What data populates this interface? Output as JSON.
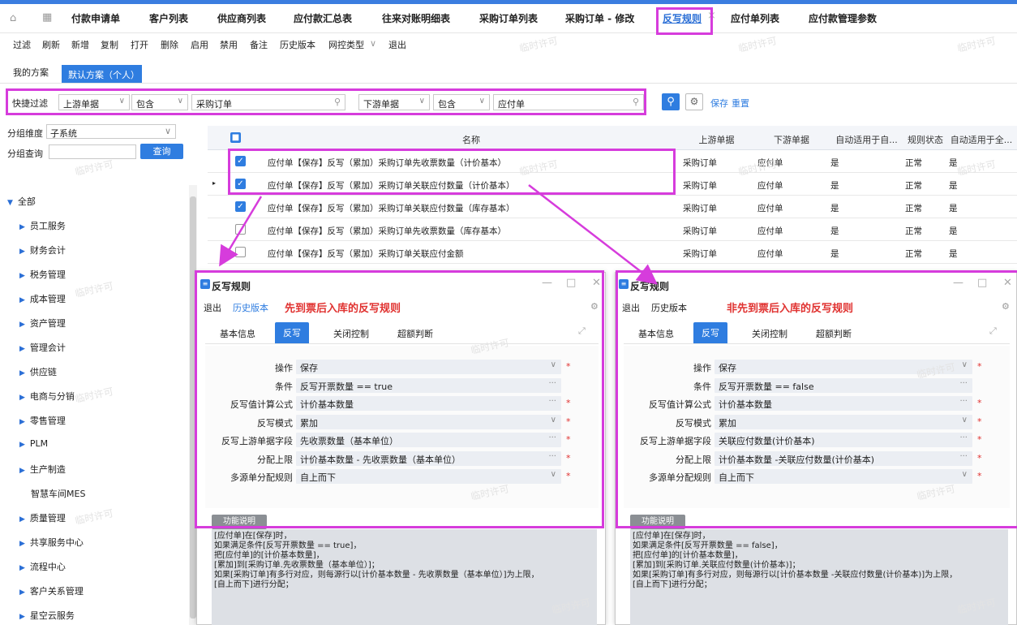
{
  "tabs": [
    "付款申请单",
    "客户列表",
    "供应商列表",
    "应付款汇总表",
    "往来对账明细表",
    "采购订单列表",
    "采购订单 - 修改",
    "反写规则",
    "应付单列表",
    "应付款管理参数"
  ],
  "toolbar": [
    "过滤",
    "刷新",
    "新增",
    "复制",
    "打开",
    "删除",
    "启用",
    "禁用",
    "备注",
    "历史版本",
    "网控类型",
    "退出"
  ],
  "plans": {
    "mine": "我的方案",
    "active": "默认方案（个人）"
  },
  "filter": {
    "label": "快捷过滤",
    "field1": "上游单据",
    "op1": "包含",
    "val1": "采购订单",
    "field2": "下游单据",
    "op2": "包含",
    "val2": "应付单",
    "save": "保存",
    "reset": "重置"
  },
  "left": {
    "group_dim_label": "分组维度",
    "group_dim_value": "子系统",
    "group_query_label": "分组查询",
    "query_button": "查询",
    "tree": [
      "全部",
      "员工服务",
      "财务会计",
      "税务管理",
      "成本管理",
      "资产管理",
      "管理会计",
      "供应链",
      "电商与分销",
      "零售管理",
      "PLM",
      "生产制造",
      "智慧车间MES",
      "质量管理",
      "共享服务中心",
      "流程中心",
      "客户关系管理",
      "星空云服务"
    ]
  },
  "grid": {
    "headers": [
      "名称",
      "上游单据",
      "下游单据",
      "自动适用于自...",
      "规则状态",
      "自动适用于全..."
    ],
    "rows": [
      {
        "name": "应付单【保存】反写（累加）采购订单先收票数量（计价基本）",
        "up": "采购订单",
        "down": "应付单",
        "auto": "是",
        "status": "正常",
        "autoall": "是",
        "checked": true
      },
      {
        "name": "应付单【保存】反写（累加）采购订单关联应付数量（计价基本）",
        "up": "采购订单",
        "down": "应付单",
        "auto": "是",
        "status": "正常",
        "autoall": "是",
        "checked": true
      },
      {
        "name": "应付单【保存】反写（累加）采购订单关联应付数量（库存基本）",
        "up": "采购订单",
        "down": "应付单",
        "auto": "是",
        "status": "正常",
        "autoall": "是",
        "checked": true
      },
      {
        "name": "应付单【保存】反写（累加）采购订单先收票数量（库存基本）",
        "up": "采购订单",
        "down": "应付单",
        "auto": "是",
        "status": "正常",
        "autoall": "是",
        "checked": false
      },
      {
        "name": "应付单【保存】反写（累加）采购订单关联应付金额",
        "up": "采购订单",
        "down": "应付单",
        "auto": "是",
        "status": "正常",
        "autoall": "是",
        "checked": false
      }
    ]
  },
  "watermark": "临时许可",
  "dialog_common": {
    "title": "反写规则",
    "exit": "退出",
    "history": "历史版本",
    "tabs": [
      "基本信息",
      "反写",
      "关闭控制",
      "超额判断"
    ],
    "func_btn": "功能说明",
    "labels": [
      "操作",
      "条件",
      "反写值计算公式",
      "反写模式",
      "反写上游单据字段",
      "分配上限",
      "多源单分配规则"
    ]
  },
  "dialog_left": {
    "note": "先到票后入库的反写规则",
    "values": [
      "保存",
      "反写开票数量 == true",
      "计价基本数量",
      "累加",
      "先收票数量（基本单位）",
      "计价基本数量 - 先收票数量（基本单位）",
      "自上而下"
    ],
    "desc": "[应付单]在[保存]时，\n如果满足条件[反写开票数量 == true]，\n把[应付单]的[计价基本数量]，\n[累加]到[采购订单.先收票数量（基本单位）]；\n如果[采购订单]有多行对应，则每源行以[计价基本数量 - 先收票数量（基本单位）]为上限，\n[自上而下]进行分配；"
  },
  "dialog_right": {
    "note": "非先到票后入库的反写规则",
    "values": [
      "保存",
      "反写开票数量 == false",
      "计价基本数量",
      "累加",
      "关联应付数量(计价基本)",
      "计价基本数量 -关联应付数量(计价基本)",
      "自上而下"
    ],
    "desc": "[应付单]在[保存]时，\n如果满足条件[反写开票数量 == false]，\n把[应付单]的[计价基本数量]，\n[累加]到[采购订单.关联应付数量(计价基本)]；\n如果[采购订单]有多行对应，则每源行以[计价基本数量 -关联应付数量(计价基本)]为上限，\n[自上而下]进行分配；"
  },
  "colors": {
    "accent": "#2f7de0",
    "highlight": "#d63cdc",
    "note": "#e0312f"
  }
}
